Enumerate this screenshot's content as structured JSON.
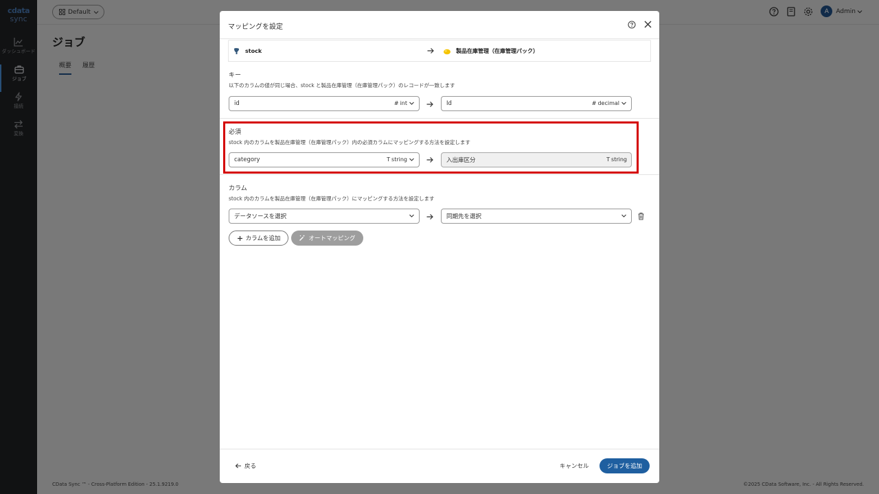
{
  "brand": {
    "line1": "cdata",
    "line2": "sync"
  },
  "sidebar": {
    "items": [
      {
        "label": "ダッシュボード",
        "icon": "chart-line-icon"
      },
      {
        "label": "ジョブ",
        "icon": "briefcase-icon"
      },
      {
        "label": "接続",
        "icon": "lightning-icon"
      },
      {
        "label": "変換",
        "icon": "arrows-swap-icon"
      }
    ],
    "active": "ジョブ"
  },
  "header": {
    "workspace": "Default",
    "user_initial": "A",
    "user_name": "Admin"
  },
  "page": {
    "title": "ジョブ",
    "tabs": [
      "概要",
      "履歴"
    ],
    "active_tab": "概要"
  },
  "footer": {
    "left": "CData Sync ™ - Cross-Platform Edition - 25.1.9219.0",
    "right": "©2025 CData Software, Inc. - All Rights Reserved."
  },
  "modal": {
    "title": "マッピングを設定",
    "source": {
      "name": "stock",
      "icon": "postgresql-icon"
    },
    "destination": {
      "name": "製品在庫管理（在庫管理パック）",
      "icon": "kintone-icon"
    },
    "key_section": {
      "title": "キー",
      "description": "以下のカラムの値が同じ場合、stock と製品在庫管理（在庫管理パック）のレコードが一致します",
      "source_field": {
        "value": "id",
        "type_symbol": "#",
        "type": "int"
      },
      "dest_field": {
        "value": "Id",
        "type_symbol": "#",
        "type": "decimal"
      }
    },
    "required_section": {
      "title": "必須",
      "description": "stock 内のカラムを製品在庫管理（在庫管理パック）内の必須カラムにマッピングする方法を設定します",
      "source_field": {
        "value": "category",
        "type_symbol": "T",
        "type": "string"
      },
      "dest_field": {
        "value": "入出庫区分",
        "type_symbol": "T",
        "type": "string"
      }
    },
    "columns_section": {
      "title": "カラム",
      "description": "stock 内のカラムを製品在庫管理（在庫管理パック）にマッピングする方法を設定します",
      "source_placeholder": "データソースを選択",
      "dest_placeholder": "同期先を選択"
    },
    "buttons": {
      "add_column": "カラムを追加",
      "auto_mapping": "オートマッピング",
      "back": "戻る",
      "cancel": "キャンセル",
      "submit": "ジョブを追加"
    },
    "colors": {
      "highlight": "#d40000",
      "primary": "#1f5fa0"
    }
  }
}
